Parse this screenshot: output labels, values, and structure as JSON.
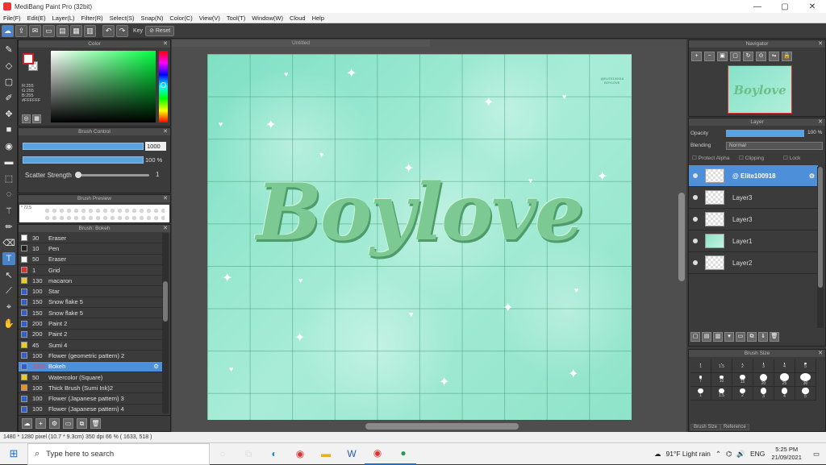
{
  "window": {
    "title": "MediBang Paint Pro (32bit)",
    "min": "—",
    "max": "▢",
    "close": "✕"
  },
  "menu": [
    "File(F)",
    "Edit(E)",
    "Layer(L)",
    "Filter(R)",
    "Select(S)",
    "Snap(N)",
    "Color(C)",
    "View(V)",
    "Tool(T)",
    "Window(W)",
    "Cloud",
    "Help"
  ],
  "toolbar": {
    "key_label": "Key",
    "reset_label": "Reset"
  },
  "color_panel": {
    "title": "Color",
    "rgb_lines": [
      "R:255",
      "G:255",
      "B:255",
      "#FFFFFF"
    ],
    "fg_color": "#ffffff",
    "accent": "#cc2222"
  },
  "brush_control": {
    "title": "Brush Control",
    "size_value": "1000",
    "opacity_value": "100 %",
    "scatter_label": "Scatter Strength",
    "scatter_value": "1"
  },
  "brush_preview": {
    "title": "Brush Preview",
    "label": "* 72.5"
  },
  "brush_list": {
    "title": "Brush: Bokeh",
    "items": [
      {
        "size": "30",
        "name": "Eraser",
        "color": "#ffffff"
      },
      {
        "size": "10",
        "name": "Pen",
        "color": "#222222"
      },
      {
        "size": "50",
        "name": "Eraser",
        "color": "#ffffff"
      },
      {
        "size": "1",
        "name": "Grid",
        "color": "#e03030"
      },
      {
        "size": "130",
        "name": "macaron",
        "color": "#e8d020"
      },
      {
        "size": "100",
        "name": "Star",
        "color": "#3060d0"
      },
      {
        "size": "150",
        "name": "Snow flake 5",
        "color": "#3060d0"
      },
      {
        "size": "150",
        "name": "Snow flake 5",
        "color": "#3060d0"
      },
      {
        "size": "200",
        "name": "Paint 2",
        "color": "#3060d0"
      },
      {
        "size": "200",
        "name": "Paint 2",
        "color": "#3060d0"
      },
      {
        "size": "45",
        "name": "Sumi 4",
        "color": "#e8d020"
      },
      {
        "size": "100",
        "name": "Flower (geometric pattern) 2",
        "color": "#3060d0"
      },
      {
        "size": "1000",
        "name": "Bokeh",
        "color": "#3060d0",
        "selected": true
      },
      {
        "size": "50",
        "name": "Watercolor (Square)",
        "color": "#e8d020"
      },
      {
        "size": "100",
        "name": "Thick Brush (Sumi Ink)2",
        "color": "#e89020"
      },
      {
        "size": "100",
        "name": "Flower (Japanese pattern) 3",
        "color": "#3060d0"
      },
      {
        "size": "100",
        "name": "Flower (Japanese pattern) 4",
        "color": "#3060d0"
      }
    ]
  },
  "canvas": {
    "tab_title": "Untitled",
    "art_text": "Boylove",
    "watermark": [
      "@ELITE100918",
      "BOYLOVE"
    ]
  },
  "navigator": {
    "title": "Navigator",
    "thumb_text": "Boylove"
  },
  "layer_panel": {
    "title": "Layer",
    "opacity_label": "Opacity",
    "opacity_value": "100 %",
    "opacity_fraction": 1.0,
    "blending_label": "Blending",
    "blending_value": "Normal",
    "protect_alpha": "Protect Alpha",
    "clipping": "Clipping",
    "lock": "Lock",
    "layers": [
      {
        "name": "@ Elite100918",
        "selected": true,
        "thumb": "text"
      },
      {
        "name": "Layer3",
        "thumb": "text"
      },
      {
        "name": "Layer3",
        "thumb": "text"
      },
      {
        "name": "Layer1",
        "thumb": "green"
      },
      {
        "name": "Layer2",
        "thumb": "empty"
      }
    ]
  },
  "brush_size_panel": {
    "title": "Brush Size",
    "sizes": [
      "1",
      "1.5",
      "2",
      "3",
      "4",
      "5",
      "7",
      "10",
      "15",
      "20",
      "25",
      "30",
      "1",
      "1.5",
      "2",
      "3",
      "4",
      "5"
    ],
    "tabs": [
      "Brush Size",
      "Reference"
    ]
  },
  "status": "1480 * 1280 pixel  (10.7 * 9.3cm)  350 dpi  66 %  ( 1633, 518 )",
  "taskbar": {
    "search_placeholder": "Type here to search",
    "weather": "91°F  Light rain",
    "lang": "ENG",
    "time": "5:25 PM",
    "date": "21/09/2021"
  }
}
